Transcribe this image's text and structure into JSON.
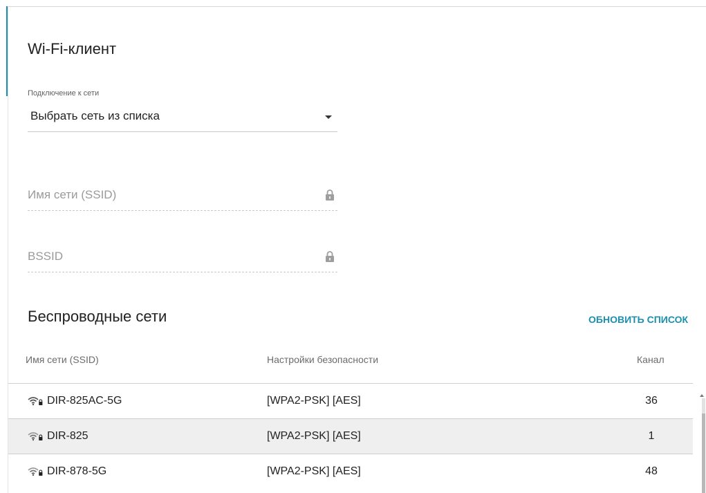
{
  "form": {
    "title": "Wi-Fi-клиент",
    "connection_label": "Подключение к сети",
    "connection_value": "Выбрать сеть из списка",
    "ssid_placeholder": "Имя сети (SSID)",
    "bssid_placeholder": "BSSID"
  },
  "networks": {
    "title": "Беспроводные сети",
    "refresh_label": "ОБНОВИТЬ СПИСОК",
    "columns": {
      "ssid": "Имя сети (SSID)",
      "security": "Настройки безопасности",
      "channel": "Канал"
    },
    "rows": [
      {
        "ssid": "DIR-825AC-5G",
        "security": "[WPA2-PSK] [AES]",
        "channel": "36",
        "icon": "wifi-locked-icon"
      },
      {
        "ssid": "DIR-825",
        "security": "[WPA2-PSK] [AES]",
        "channel": "1",
        "icon": "wifi-locked-icon"
      },
      {
        "ssid": "DIR-878-5G",
        "security": "[WPA2-PSK] [AES]",
        "channel": "48",
        "icon": "wifi-locked-icon"
      }
    ]
  },
  "colors": {
    "accent": "#1a8fb0",
    "row_alt": "#efefef",
    "placeholder": "#9a9a9a"
  }
}
